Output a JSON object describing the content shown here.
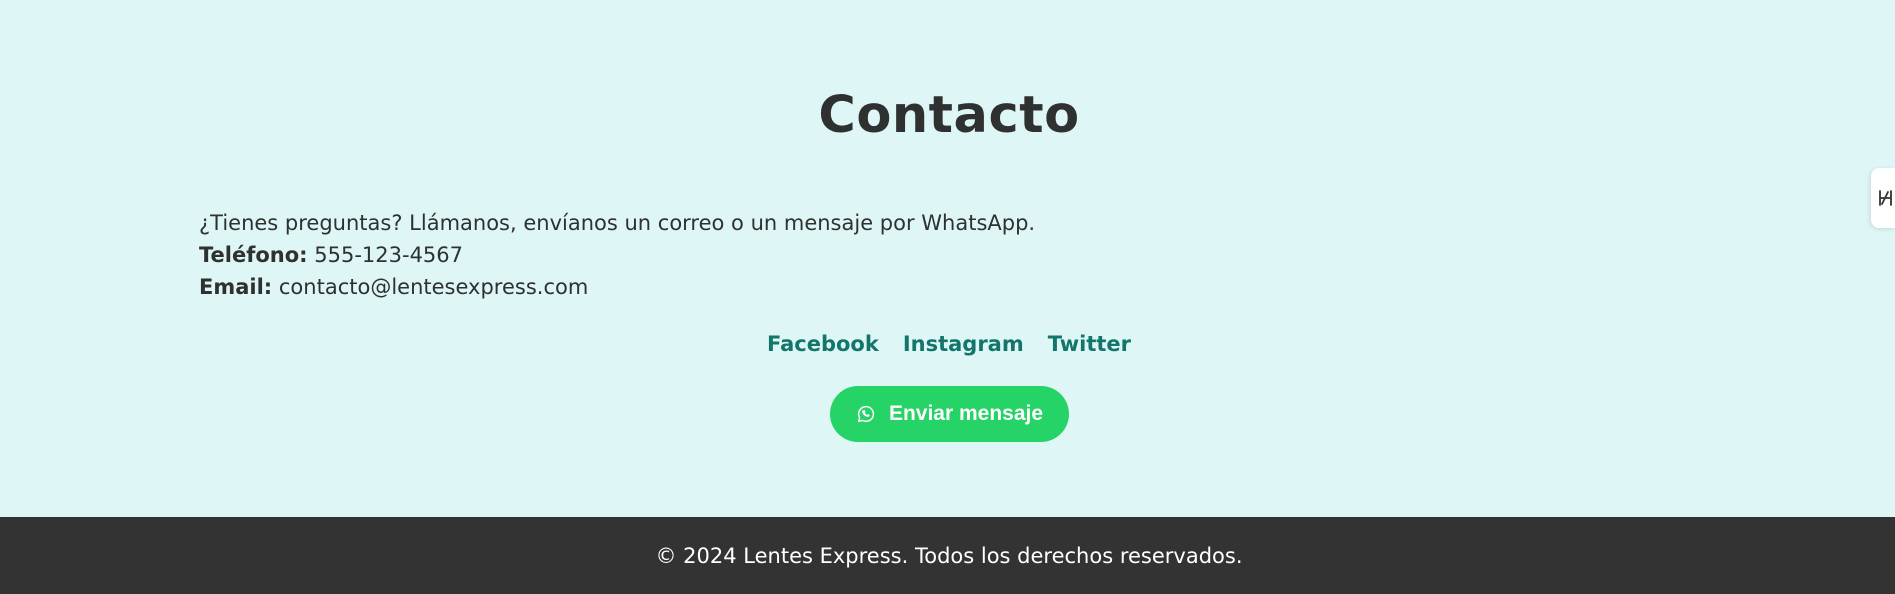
{
  "contact": {
    "title": "Contacto",
    "intro": "¿Tienes preguntas? Llámanos, envíanos un correo o un mensaje por WhatsApp.",
    "phone_label": "Teléfono:",
    "phone_value": "555-123-4567",
    "email_label": "Email:",
    "email_value": "contacto@lentesexpress.com"
  },
  "social_links": [
    {
      "label": "Facebook",
      "icon": "facebook-link"
    },
    {
      "label": "Instagram",
      "icon": "instagram-link"
    },
    {
      "label": "Twitter",
      "icon": "twitter-link"
    }
  ],
  "whatsapp_button": {
    "label": "Enviar mensaje",
    "icon": "whatsapp-icon"
  },
  "footer": {
    "text": "© 2024 Lentes Express. Todos los derechos reservados."
  },
  "side_widget": {
    "icon": "extension-toggle-icon"
  },
  "colors": {
    "section_background": "#dff6f7",
    "heading_text": "#2e3130",
    "link_accent": "#12766a",
    "whatsapp_green": "#25d366",
    "footer_background": "#333333",
    "footer_text": "#ffffff"
  }
}
